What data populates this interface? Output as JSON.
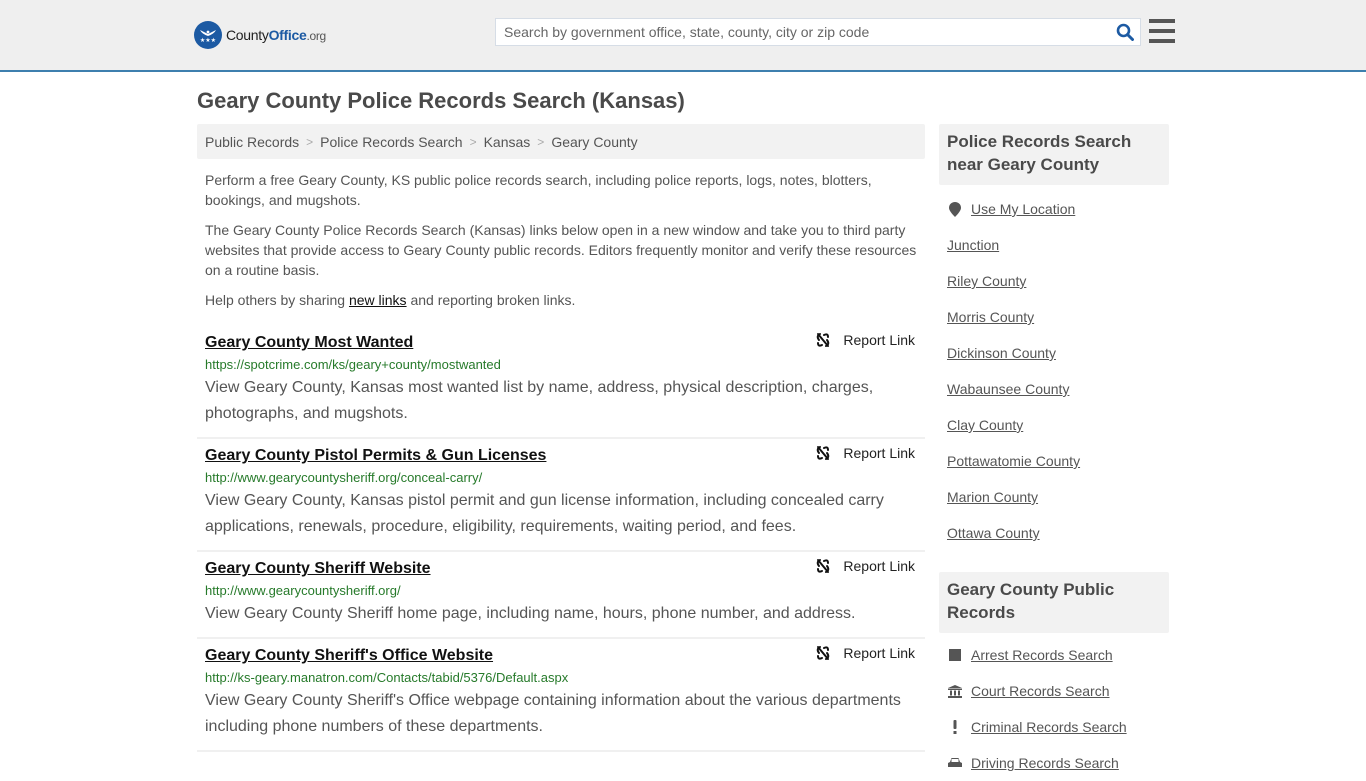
{
  "header": {
    "logo": {
      "brand_prefix": "County",
      "brand_main": "Office",
      "brand_suffix": ".org"
    },
    "search": {
      "placeholder": "Search by government office, state, county, city or zip code",
      "value": ""
    },
    "icons": {
      "search": "search-icon",
      "menu": "hamburger-menu-icon"
    }
  },
  "page": {
    "title": "Geary County Police Records Search (Kansas)",
    "breadcrumb": [
      "Public Records",
      "Police Records Search",
      "Kansas",
      "Geary County"
    ],
    "breadcrumb_separator": ">",
    "intro": {
      "p1": "Perform a free Geary County, KS public police records search, including police reports, logs, notes, blotters, bookings, and mugshots.",
      "p2": "The Geary County Police Records Search (Kansas) links below open in a new window and take you to third party websites that provide access to Geary County public records. Editors frequently monitor and verify these resources on a routine basis.",
      "p3_before": "Help others by sharing ",
      "p3_link": "new links",
      "p3_after": " and reporting broken links."
    }
  },
  "results": [
    {
      "title": "Geary County Most Wanted",
      "url": "https://spotcrime.com/ks/geary+county/mostwanted",
      "description": "View Geary County, Kansas most wanted list by name, address, physical description, charges, photographs, and mugshots.",
      "report_label": "Report Link"
    },
    {
      "title": "Geary County Pistol Permits & Gun Licenses",
      "url": "http://www.gearycountysheriff.org/conceal-carry/",
      "description": "View Geary County, Kansas pistol permit and gun license information, including concealed carry applications, renewals, procedure, eligibility, requirements, waiting period, and fees.",
      "report_label": "Report Link"
    },
    {
      "title": "Geary County Sheriff Website",
      "url": "http://www.gearycountysheriff.org/",
      "description": "View Geary County Sheriff home page, including name, hours, phone number, and address.",
      "report_label": "Report Link"
    },
    {
      "title": "Geary County Sheriff's Office Website",
      "url": "http://ks-geary.manatron.com/Contacts/tabid/5376/Default.aspx",
      "description": "View Geary County Sheriff's Office webpage containing information about the various departments including phone numbers of these departments.",
      "report_label": "Report Link"
    }
  ],
  "sidebar": {
    "nearby": {
      "heading": "Police Records Search near Geary County",
      "use_location": "Use My Location",
      "items": [
        "Junction",
        "Riley County",
        "Morris County",
        "Dickinson County",
        "Wabaunsee County",
        "Clay County",
        "Pottawatomie County",
        "Marion County",
        "Ottawa County"
      ]
    },
    "public_records": {
      "heading": "Geary County Public Records",
      "items": [
        {
          "label": "Arrest Records Search",
          "icon": "square-icon"
        },
        {
          "label": "Court Records Search",
          "icon": "courthouse-icon"
        },
        {
          "label": "Criminal Records Search",
          "icon": "exclamation-icon"
        },
        {
          "label": "Driving Records Search",
          "icon": "car-icon"
        }
      ]
    }
  },
  "colors": {
    "accent_blue": "#1c5aa3",
    "header_border": "#3d7fae",
    "url_green": "#267a2a"
  }
}
